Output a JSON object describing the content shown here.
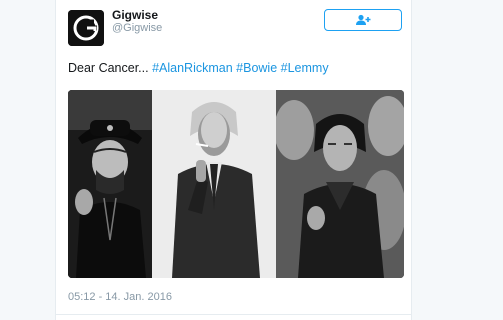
{
  "tweet": {
    "author": {
      "display_name": "Gigwise",
      "handle": "@Gigwise",
      "avatar_letter": "G",
      "avatar_icon": "gigwise-logo"
    },
    "follow_button": {
      "icon": "add-user-icon",
      "color": "#1da1f2"
    },
    "text_prefix": "Dear Cancer... ",
    "hashtags": [
      "#AlanRickman",
      "#Bowie",
      "#Lemmy"
    ],
    "hashtag_color": "#1b95e0",
    "media": {
      "panels": [
        "lemmy-photo",
        "bowie-photo",
        "rickman-photo"
      ]
    },
    "timestamp": "05:12 - 14. Jan. 2016"
  }
}
